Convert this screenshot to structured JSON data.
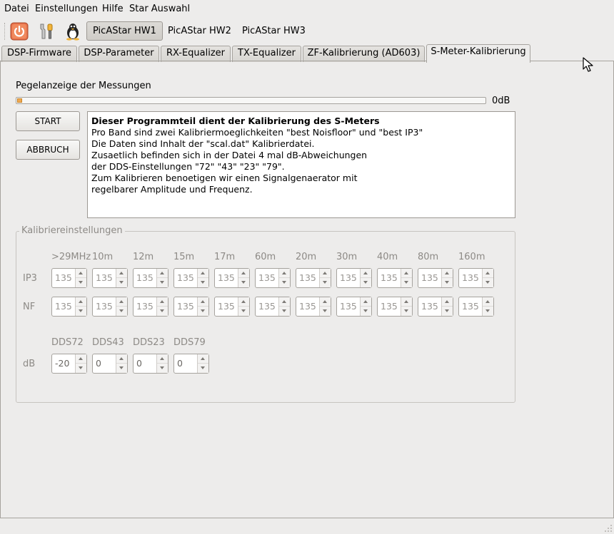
{
  "menubar": {
    "items": [
      "Datei",
      "Einstellungen",
      "Hilfe",
      "Star Auswahl"
    ]
  },
  "toolbar": {
    "icons": [
      "power-icon",
      "tools-icon",
      "tux-icon"
    ],
    "buttons": [
      "PicAStar HW1",
      "PicAStar HW2",
      "PicAStar HW3"
    ],
    "active_button": "PicAStar HW1"
  },
  "tabs": {
    "items": [
      "DSP-Firmware",
      "DSP-Parameter",
      "RX-Equalizer",
      "TX-Equalizer",
      "ZF-Kalibrierung (AD603)",
      "S-Meter-Kalibrierung"
    ],
    "active": "S-Meter-Kalibrierung"
  },
  "level": {
    "label": "Pegelanzeige der Messungen",
    "value_label": "0dB",
    "fill_fraction": 0.01
  },
  "actions": {
    "start": "START",
    "abort": "ABBRUCH"
  },
  "info": {
    "title": "Dieser Programmteil dient der Kalibrierung des S-Meters",
    "lines": [
      "Pro Band sind zwei Kalibriermoeglichkeiten \"best Noisfloor\" und \"best IP3\"",
      "Die Daten sind Inhalt der \"scal.dat\" Kalibrierdatei.",
      "Zusaetlich befinden sich in der Datei 4 mal dB-Abweichungen",
      "der DDS-Einstellungen \"72\" \"43\" \"23\" \"79\".",
      "Zum Kalibrieren benoetigen wir einen Signalgenaerator mit",
      "regelbarer Amplitude und Frequenz."
    ]
  },
  "calibration": {
    "title": "Kalibriereinstellungen",
    "bands": [
      ">29MHz",
      "10m",
      "12m",
      "15m",
      "17m",
      "60m",
      "20m",
      "30m",
      "40m",
      "80m",
      "160m"
    ],
    "ip3_label": "IP3",
    "nf_label": "NF",
    "ip3_values": [
      "135",
      "135",
      "135",
      "135",
      "135",
      "135",
      "135",
      "135",
      "135",
      "135",
      "135"
    ],
    "nf_values": [
      "135",
      "135",
      "135",
      "135",
      "135",
      "135",
      "135",
      "135",
      "135",
      "135",
      "135"
    ],
    "dds_headers": [
      "DDS72",
      "DDS43",
      "DDS23",
      "DDS79"
    ],
    "db_label": "dB",
    "db_values": [
      "-20",
      "0",
      "0",
      "0"
    ]
  }
}
